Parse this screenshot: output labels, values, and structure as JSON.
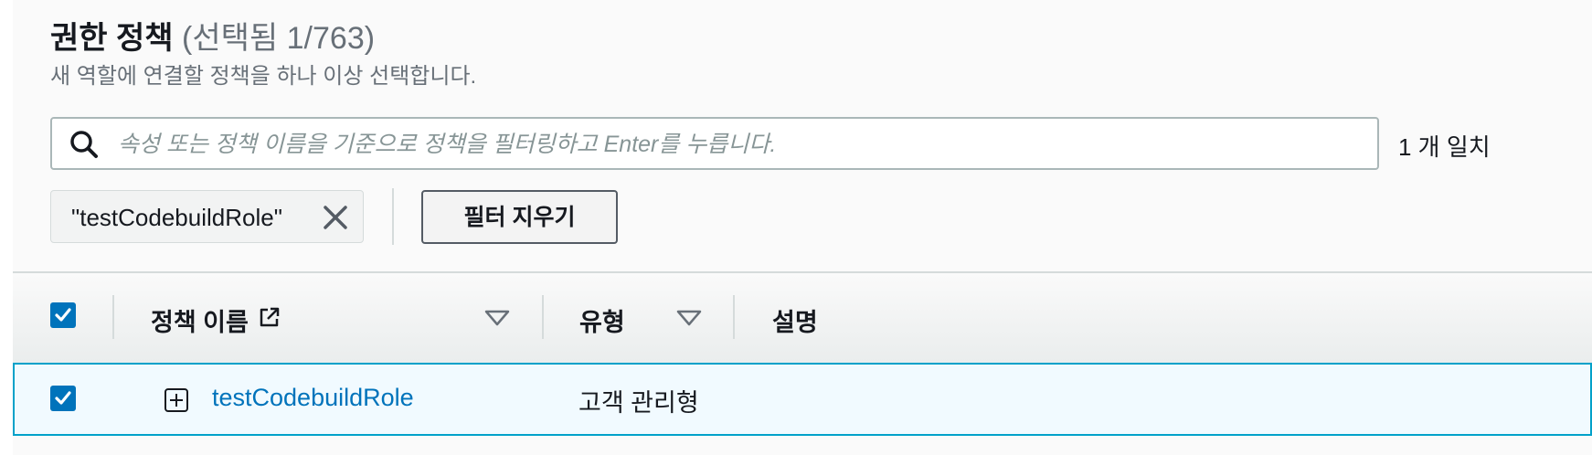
{
  "header": {
    "title": "권한 정책",
    "selection_count": "(선택됨 1/763)",
    "description": "새 역할에 연결할 정책을 하나 이상 선택합니다."
  },
  "search": {
    "placeholder": "속성 또는 정책 이름을 기준으로 정책을 필터링하고 Enter를 누릅니다.",
    "value": "",
    "match_count": "1 개 일치"
  },
  "filter": {
    "token_label": "\"testCodebuildRole\"",
    "clear_label": "필터 지우기"
  },
  "table": {
    "columns": [
      {
        "label": "정책 이름"
      },
      {
        "label": "유형"
      },
      {
        "label": "설명"
      }
    ],
    "header_checkbox_checked": true,
    "rows": [
      {
        "checked": true,
        "name": "testCodebuildRole",
        "type": "고객 관리형",
        "description": ""
      }
    ]
  },
  "colors": {
    "accent": "#0073bb",
    "selected_row_bg": "#f1faff",
    "selected_row_border": "#00a1c9"
  }
}
